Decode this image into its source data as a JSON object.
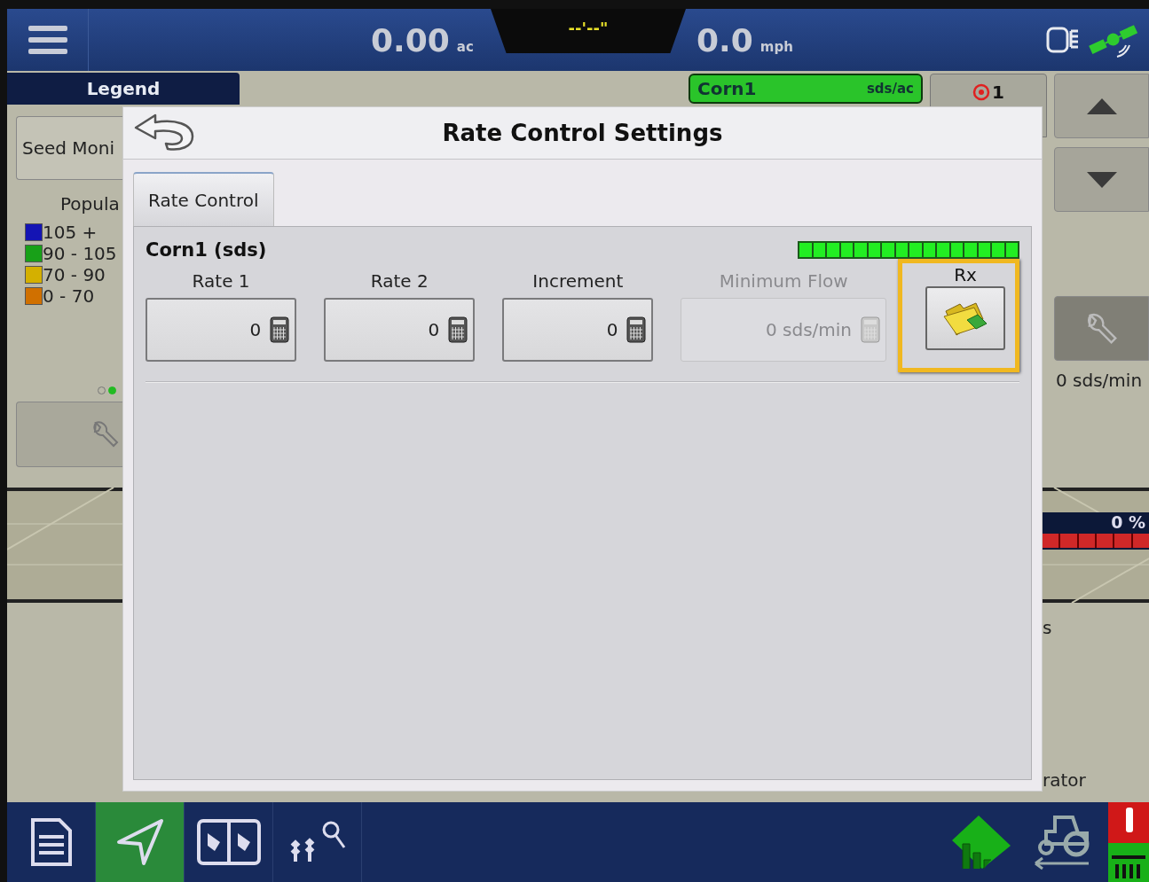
{
  "top_bar": {
    "area": {
      "value": "0.00",
      "unit": "ac"
    },
    "center_readout": "--'--\"",
    "speed": {
      "value": "0.0",
      "unit": "mph"
    }
  },
  "legend_tab": "Legend",
  "left_panel": {
    "mode_button": "Seed Moni",
    "heading": "Popula",
    "legend": [
      {
        "label": "105 +",
        "color": "#1414b4"
      },
      {
        "label": "90 - 105",
        "color": "#18a018"
      },
      {
        "label": "70 - 90",
        "color": "#d4b000"
      },
      {
        "label": "0 - 70",
        "color": "#d07000"
      }
    ],
    "pages": [
      {
        "selected": false
      },
      {
        "selected": true
      }
    ]
  },
  "product_badge": {
    "name": "Corn1",
    "unit": "sds/ac"
  },
  "alert_tab": {
    "count": "1"
  },
  "right_panel": {
    "flow_reading": "0 sds/min",
    "coverage_reading": "0 %",
    "label_1": "s",
    "label_2": "rator"
  },
  "dialog": {
    "title": "Rate Control Settings",
    "tabs": [
      {
        "label": "Rate Control",
        "selected": true
      }
    ],
    "product": "Corn1 (sds)",
    "settings": [
      {
        "kind": "field",
        "label": "Rate 1",
        "value": "0",
        "disabled": false
      },
      {
        "kind": "field",
        "label": "Rate 2",
        "value": "0",
        "disabled": false
      },
      {
        "kind": "field",
        "label": "Increment",
        "value": "0",
        "disabled": false
      },
      {
        "kind": "field",
        "label": "Minimum Flow",
        "value": "0 sds/min",
        "disabled": true
      },
      {
        "kind": "button",
        "label": "Rx",
        "disabled": false,
        "highlighted": true
      }
    ]
  },
  "bottom_bar": {
    "items": [
      {
        "kind": "document",
        "selected": false
      },
      {
        "kind": "guidance",
        "selected": true
      },
      {
        "kind": "split",
        "selected": false
      },
      {
        "kind": "plants",
        "selected": false
      }
    ]
  }
}
